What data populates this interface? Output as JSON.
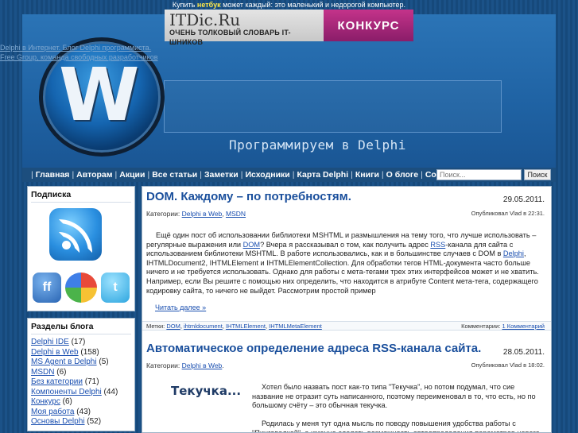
{
  "topbar": {
    "before": "Купить",
    "link": "нетбук",
    "after": "может каждый: это маленький и недорогой компьютер."
  },
  "ad": {
    "title": "ITDic.Ru",
    "subtitle": "ОЧЕНЬ ТОЛКОВЫЙ СЛОВАРЬ IT-ШНИКОВ",
    "contest": "КОНКУРС"
  },
  "topleft": {
    "line1": "Delphi в Интернет. Блог Delphi программиста.",
    "line2": "Free Group, команда свободных разработчиков"
  },
  "header": {
    "tagline": "Программируем в Delphi"
  },
  "nav": {
    "items": [
      "Главная",
      "Авторам",
      "Акции",
      "Все статьи",
      "Заметки",
      "Исходники",
      "Карта Delphi",
      "Книги",
      "О блоге",
      "Софт"
    ]
  },
  "search": {
    "placeholder": "Поиск...",
    "button": "Поиск"
  },
  "sidebar": {
    "subscribe_title": "Подписка",
    "icons": {
      "ff": "ff",
      "tw": "t"
    },
    "categories_title": "Разделы блога",
    "categories": [
      {
        "name": "Delphi IDE",
        "count": "(17)"
      },
      {
        "name": "Delphi в Web",
        "count": "(158)"
      },
      {
        "name": "MS Agent в Delphi",
        "count": "(5)"
      },
      {
        "name": "MSDN",
        "count": "(6)"
      },
      {
        "name": "Без категории",
        "count": "(71)"
      },
      {
        "name": "Компоненты Delphi",
        "count": "(44)"
      },
      {
        "name": "Конкурс",
        "count": "(6)"
      },
      {
        "name": "Моя работа",
        "count": "(43)"
      },
      {
        "name": "Основы Delphi",
        "count": "(52)"
      }
    ]
  },
  "posts": [
    {
      "title": "DOM. Каждому – по потребностям.",
      "date": "29.05.2011.",
      "categories_label": "Категории:",
      "categories": [
        "Delphi в Web",
        "MSDN"
      ],
      "published": "Опубликовал Vlad в 22:31.",
      "body": [
        {
          "t": "Ещё один пост об использовании библиотеки MSHTML и размышления на тему того, что лучше использовать – регулярные выражения или "
        },
        {
          "l": "DOM"
        },
        {
          "t": "? Вчера я рассказывал о том, как получить адрес "
        },
        {
          "l": "RSS"
        },
        {
          "t": "-канала для сайта с использованием библиотеки MSHTML. В работе использовались, как и в большинстве случаев с DOM в "
        },
        {
          "l": "Delphi"
        },
        {
          "t": ", IHTMLDocument2, IHTMLElement и IHTMLElementCollection. Для обработки тегов HTML-документа часто больше ничего и не требуется использовать. Однако для работы с мета-тегами трех этих интерфейсов может и не хватить. Например, если Вы решите с помощью них определить, что находится в атрибуте Content мета-тега, содержащего кодировку сайта, то ничего не выйдет. Рассмотрим простой пример"
        }
      ],
      "readmore": "Читать далее »",
      "tags_label": "Метки:",
      "tags": [
        "DOM",
        "ihtmldocument",
        "IHTMLElement",
        "IHTMLMetaElement"
      ],
      "comments_label": "Комментарии:",
      "comments": "1 Комментарий"
    },
    {
      "title": "Автоматическое определение адреса RSS-канала сайта.",
      "date": "28.05.2011.",
      "categories_label": "Категории:",
      "categories": [
        "Delphi в Web"
      ],
      "published": "Опубликовал Vlad в 18:02.",
      "thumb": "Текучка...",
      "p1": "Хотел было назвать пост как-то типа \"Текучка\", но потом подумал, что сие название не отразит суть написанного, поэтому переименовал в то, что есть, но по большому счёту – это обычная текучка.",
      "p2": "Родилась у меня тут одна мысль по поводу повышения удобства работы с \"Пинговалкой\", а именно сделать возможность автоопределения параметров нового"
    }
  ]
}
